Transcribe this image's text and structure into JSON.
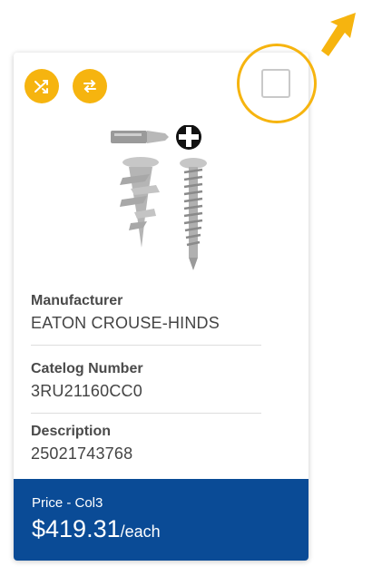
{
  "card": {
    "actions": {
      "shuffle_icon": "shuffle-icon",
      "swap_icon": "swap-arrows-icon"
    },
    "compare_checkbox": {
      "checked": false
    },
    "product_image": "screw-and-drywall-anchor-with-driver-bit",
    "fields": [
      {
        "label": "Manufacturer",
        "value": "EATON CROUSE-HINDS"
      },
      {
        "label": "Catelog Number",
        "value": "3RU21160CC0"
      },
      {
        "label": "Description",
        "value": "25021743768"
      }
    ],
    "price": {
      "label": "Price - Col3",
      "amount": "$419.31",
      "unit": "/each"
    }
  },
  "colors": {
    "accent": "#f6b40f",
    "price_bg": "#0a4b96"
  }
}
